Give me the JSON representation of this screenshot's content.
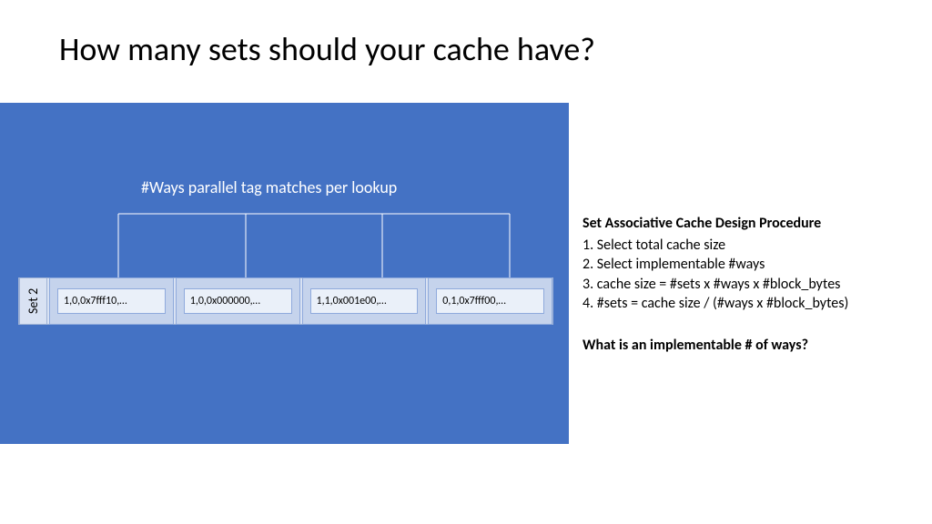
{
  "title": "How many sets should your cache have?",
  "diagram": {
    "ways_caption": "#Ways parallel tag matches per lookup",
    "set_label": "Set 2",
    "ways": [
      {
        "text": "1,0,0x7fff10,…"
      },
      {
        "text": "1,0,0x000000,…"
      },
      {
        "text": "1,1,0x001e00,…"
      },
      {
        "text": "0,1,0x7fff00,…"
      }
    ]
  },
  "procedure": {
    "heading": "Set Associative Cache Design Procedure",
    "steps": [
      "Select total cache size",
      "Select implementable #ways",
      "cache size = #sets x #ways x #block_bytes",
      "#sets = cache size / (#ways x #block_bytes)"
    ]
  },
  "question": "What is an implementable # of ways?",
  "colors": {
    "panel": "#4472c4",
    "set_fill": "#d9e2f3",
    "way_fill": "#c5d3ec",
    "inner_fill": "#eaf0f9"
  }
}
